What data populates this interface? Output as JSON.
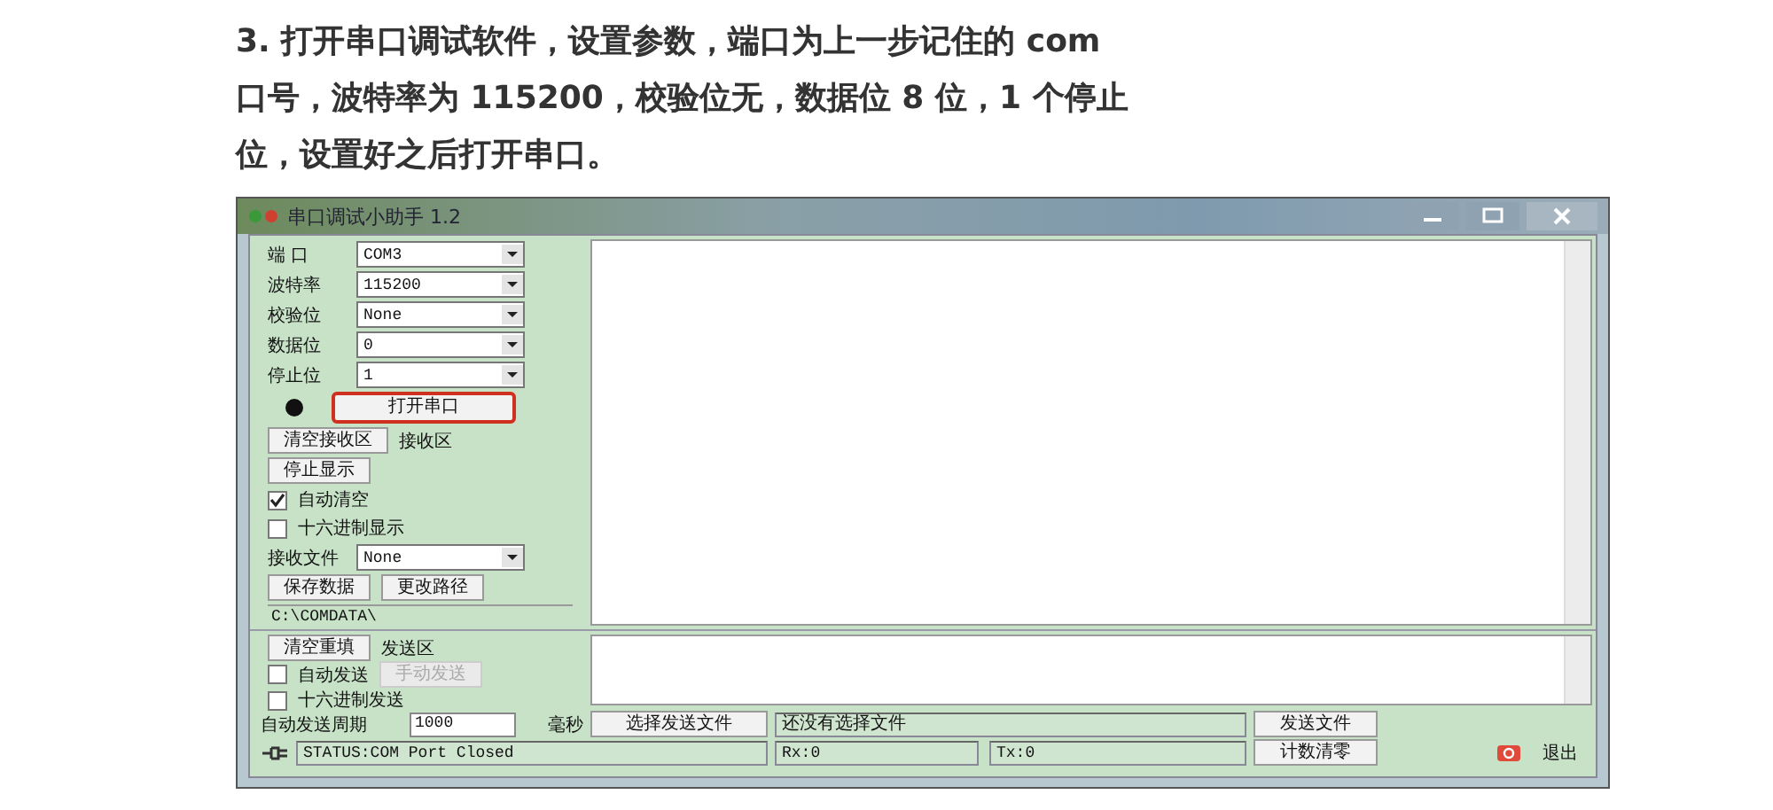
{
  "instruction": {
    "lines": [
      "3. 打开串口调试软件，设置参数，端口为上一步记住的 com",
      "口号，波特率为 115200，校验位无，数据位 8 位，1 个停止",
      "位，设置好之后打开串口。"
    ]
  },
  "window": {
    "title": "串口调试小助手 1.2"
  },
  "settings": [
    {
      "label": "端 口",
      "value": "COM3"
    },
    {
      "label": "波特率",
      "value": "115200"
    },
    {
      "label": "校验位",
      "value": "None"
    },
    {
      "label": "数据位",
      "value": "0"
    },
    {
      "label": "停止位",
      "value": "1"
    }
  ],
  "port": {
    "on": false,
    "button": "打开串口",
    "highlighted": true
  },
  "receive": {
    "clear_button": "清空接收区",
    "area_label": "接收区",
    "stop_button": "停止显示",
    "checkboxes": [
      {
        "label": "自动清空",
        "checked": true
      },
      {
        "label": "十六进制显示",
        "checked": false
      }
    ],
    "file_label": "接收文件",
    "file_value": "None",
    "save_button": "保存数据",
    "path_button": "更改路径",
    "path": "C:\\COMDATA\\"
  },
  "send": {
    "clear_button": "清空重填",
    "area_label": "发送区",
    "auto_send": {
      "label": "自动发送",
      "checked": false
    },
    "manual_button": {
      "label": "手动发送",
      "disabled": true
    },
    "hex_send": {
      "label": "十六进制发送",
      "checked": false
    },
    "period_label": "自动发送周期",
    "period_value": "1000",
    "period_unit": "毫秒",
    "choose_file_button": "选择发送文件",
    "file_status": "还没有选择文件",
    "send_file_button": "发送文件"
  },
  "status_bar": {
    "status": "STATUS:COM Port Closed",
    "rx": "Rx:0",
    "tx": "Tx:0",
    "reset_button": "计数清零",
    "exit_button": "退出"
  }
}
